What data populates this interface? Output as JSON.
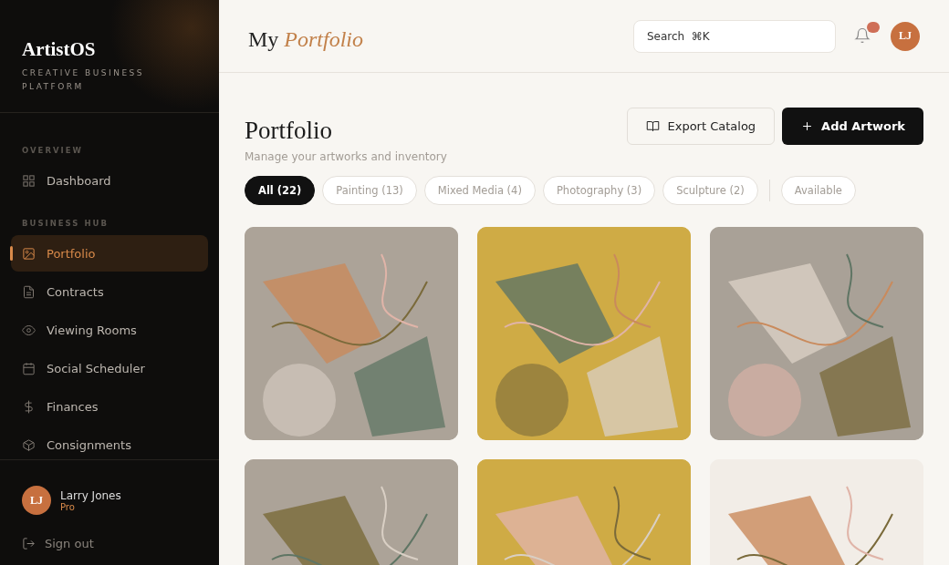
{
  "sidebar": {
    "brand": "ArtistOS",
    "tagline": "CREATIVE BUSINESS PLATFORM",
    "sections": [
      {
        "heading": "OVERVIEW",
        "items": [
          {
            "label": "Dashboard",
            "kind": "grid",
            "selected": false
          }
        ]
      },
      {
        "heading": "BUSINESS HUB",
        "items": [
          {
            "label": "Portfolio",
            "kind": "image",
            "selected": true
          },
          {
            "label": "Contracts",
            "kind": "file",
            "selected": false
          },
          {
            "label": "Viewing Rooms",
            "kind": "eye",
            "selected": false
          },
          {
            "label": "Social Scheduler",
            "kind": "calendar",
            "selected": false
          },
          {
            "label": "Finances",
            "kind": "dollar",
            "selected": false
          },
          {
            "label": "Consignments",
            "kind": "box",
            "selected": false
          }
        ]
      }
    ],
    "user": {
      "initials": "LJ",
      "name": "Larry Jones",
      "plan": "Pro"
    },
    "sign_out": "Sign out"
  },
  "header": {
    "title": "My *Portfolio*",
    "search": {
      "placeholder": "Search  ⌘K"
    },
    "avatar": "LJ"
  },
  "page": {
    "title": "Portfolio",
    "subtitle": "Manage your artworks and inventory",
    "buttons": [
      {
        "label": "Export Catalog",
        "kind": "secondary"
      },
      {
        "label": "Add Artwork",
        "kind": "primary"
      }
    ],
    "filters": [
      {
        "label": "All (22)",
        "selected": true
      },
      {
        "label": "Painting (13)",
        "selected": false
      },
      {
        "label": "Mixed Media (4)",
        "selected": false
      },
      {
        "label": "Photography (3)",
        "selected": false
      },
      {
        "label": "Sculpture (2)",
        "selected": false
      },
      {
        "label": "Available",
        "selected": false
      }
    ],
    "artworks": [
      {
        "color": "#aca398"
      },
      {
        "color": "#cfab45"
      },
      {
        "color": "#a9a197"
      },
      {
        "color": "#aca398"
      },
      {
        "color": "#cfab45"
      },
      {
        "color": "#f2ede7"
      }
    ]
  }
}
